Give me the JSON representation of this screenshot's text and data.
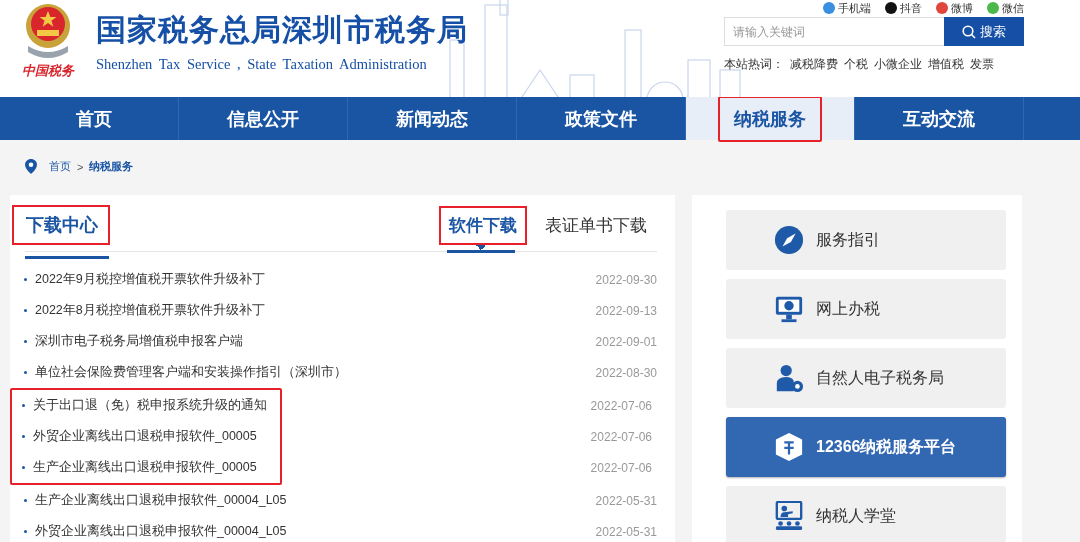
{
  "top_links": [
    {
      "label": "手机端",
      "color": "#3b8fe0"
    },
    {
      "label": "抖音",
      "color": "#111111"
    },
    {
      "label": "微博",
      "color": "#e0463c"
    },
    {
      "label": "微信",
      "color": "#4cb84c"
    }
  ],
  "header": {
    "title": "国家税务总局深圳市税务局",
    "subtitle": "Shenzhen Tax Service , State Taxation Administration",
    "logo_caption": "中国税务"
  },
  "search": {
    "placeholder": "请输入关键词",
    "button": "搜索"
  },
  "hot_words": {
    "label": "本站热词：",
    "words": [
      "减税降费",
      "个税",
      "小微企业",
      "增值税",
      "发票"
    ]
  },
  "nav": [
    {
      "label": "首页",
      "selected": false,
      "highlighted": false
    },
    {
      "label": "信息公开",
      "selected": false,
      "highlighted": false
    },
    {
      "label": "新闻动态",
      "selected": false,
      "highlighted": false
    },
    {
      "label": "政策文件",
      "selected": false,
      "highlighted": false
    },
    {
      "label": "纳税服务",
      "selected": true,
      "highlighted": true
    },
    {
      "label": "互动交流",
      "selected": false,
      "highlighted": false
    }
  ],
  "breadcrumb": {
    "items": [
      "首页",
      "纳税服务"
    ],
    "separator": ">"
  },
  "downloads": {
    "title": "下载中心",
    "title_highlighted": true,
    "tabs": [
      {
        "label": "软件下载",
        "selected": true,
        "highlighted": true
      },
      {
        "label": "表证单书下载",
        "selected": false,
        "highlighted": false
      }
    ],
    "items": [
      {
        "title": "2022年9月税控增值税开票软件升级补丁",
        "date": "2022-09-30",
        "highlighted": false
      },
      {
        "title": "2022年8月税控增值税开票软件升级补丁",
        "date": "2022-09-13",
        "highlighted": false
      },
      {
        "title": "深圳市电子税务局增值税申报客户端",
        "date": "2022-09-01",
        "highlighted": false
      },
      {
        "title": "单位社会保险费管理客户端和安装操作指引（深圳市）",
        "date": "2022-08-30",
        "highlighted": false
      },
      {
        "title": "关于出口退（免）税申报系统升级的通知",
        "date": "2022-07-06",
        "highlighted": true
      },
      {
        "title": "外贸企业离线出口退税申报软件_00005",
        "date": "2022-07-06",
        "highlighted": true
      },
      {
        "title": "生产企业离线出口退税申报软件_00005",
        "date": "2022-07-06",
        "highlighted": true
      },
      {
        "title": "生产企业离线出口退税申报软件_00004_L05",
        "date": "2022-05-31",
        "highlighted": false
      },
      {
        "title": "外贸企业离线出口退税申报软件_00004_L05",
        "date": "2022-05-31",
        "highlighted": false
      }
    ]
  },
  "services": [
    {
      "label": "服务指引",
      "kind": "compass",
      "selected": false
    },
    {
      "label": "网上办税",
      "kind": "monitor",
      "selected": false
    },
    {
      "label": "自然人电子税务局",
      "kind": "person",
      "selected": false
    },
    {
      "label": "12366纳税服务平台",
      "kind": "cube",
      "selected": true
    },
    {
      "label": "纳税人学堂",
      "kind": "classroom",
      "selected": false
    }
  ]
}
